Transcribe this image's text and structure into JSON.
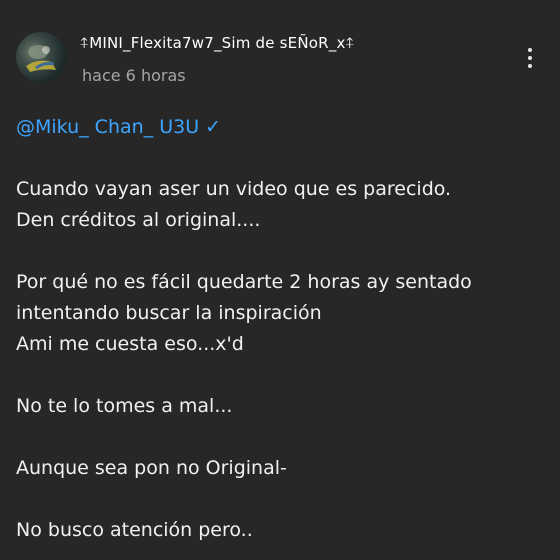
{
  "post": {
    "author": "⍏MINI_Flexita7w7_Sim de  sEÑoR_x⍏",
    "timestamp": "hace 6 horas",
    "mention": "@Miku_ Chan_ U3U ✓",
    "paragraphs": [
      [
        "Cuando vayan aser un video que es parecido.",
        "Den créditos al original...."
      ],
      [
        "Por qué no es fácil quedarte 2 horas ay sentado",
        "intentando buscar la inspiración",
        "Ami me cuesta eso...x'd"
      ],
      [
        "No te lo tomes a mal..."
      ],
      [
        "Aunque sea pon no Original-"
      ],
      [
        "No busco atención pero.."
      ]
    ]
  },
  "icons": {
    "menu": "more-vertical-icon"
  },
  "colors": {
    "background": "#272727",
    "text": "#f1f1f1",
    "secondary": "#a7a7a7",
    "mention": "#3ea6ff"
  }
}
